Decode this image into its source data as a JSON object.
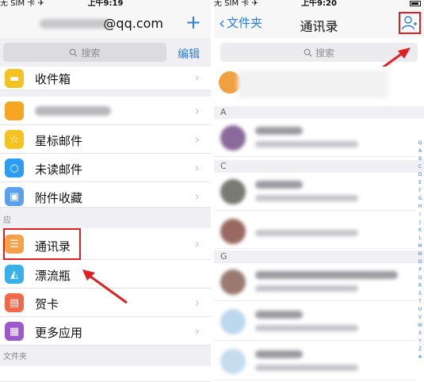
{
  "left": {
    "status": {
      "carrier": "无 SIM 卡 ✈",
      "time": "上午9:19"
    },
    "nav": {
      "account": "@qq.com",
      "plus": "+"
    },
    "search": {
      "placeholder": "搜索",
      "edit": "编辑"
    },
    "items": [
      {
        "label": "收件箱",
        "color": "#f5c223",
        "icon": "inbox-icon"
      },
      {
        "label": "",
        "color": "#f5a623",
        "icon": "blurred-icon"
      },
      {
        "label": "星标邮件",
        "color": "#f5c223",
        "icon": "star-icon"
      },
      {
        "label": "未读邮件",
        "color": "#2d9cf5",
        "icon": "unread-icon"
      },
      {
        "label": "附件收藏",
        "color": "#5aa0ee",
        "icon": "attachment-icon"
      },
      {
        "label": "通讯录",
        "color": "#f5a04a",
        "icon": "contacts-icon"
      },
      {
        "label": "漂流瓶",
        "color": "#3ab0e8",
        "icon": "bottle-icon"
      },
      {
        "label": "贺卡",
        "color": "#f06a4a",
        "icon": "card-icon"
      },
      {
        "label": "更多应用",
        "color": "#9b59c9",
        "icon": "apps-icon"
      }
    ],
    "section_label": "应",
    "footer_label": "文件夹"
  },
  "right": {
    "status": {
      "carrier": "无 SIM 卡 ✈",
      "time": "上午9:20"
    },
    "nav": {
      "back": "文件夹",
      "title": "通讯录"
    },
    "search": {
      "placeholder": "搜索"
    },
    "sections": [
      "A",
      "C",
      "G"
    ],
    "index": [
      "Q",
      "A",
      "B",
      "C",
      "D",
      "E",
      "F",
      "G",
      "H",
      "I",
      "J",
      "K",
      "L",
      "M",
      "N",
      "O",
      "P",
      "Q",
      "R",
      "S",
      "T",
      "U",
      "V",
      "W",
      "X",
      "Y",
      "Z",
      "#"
    ],
    "colors": {
      "accent": "#2b7de1",
      "highlight": "#e02020"
    }
  }
}
